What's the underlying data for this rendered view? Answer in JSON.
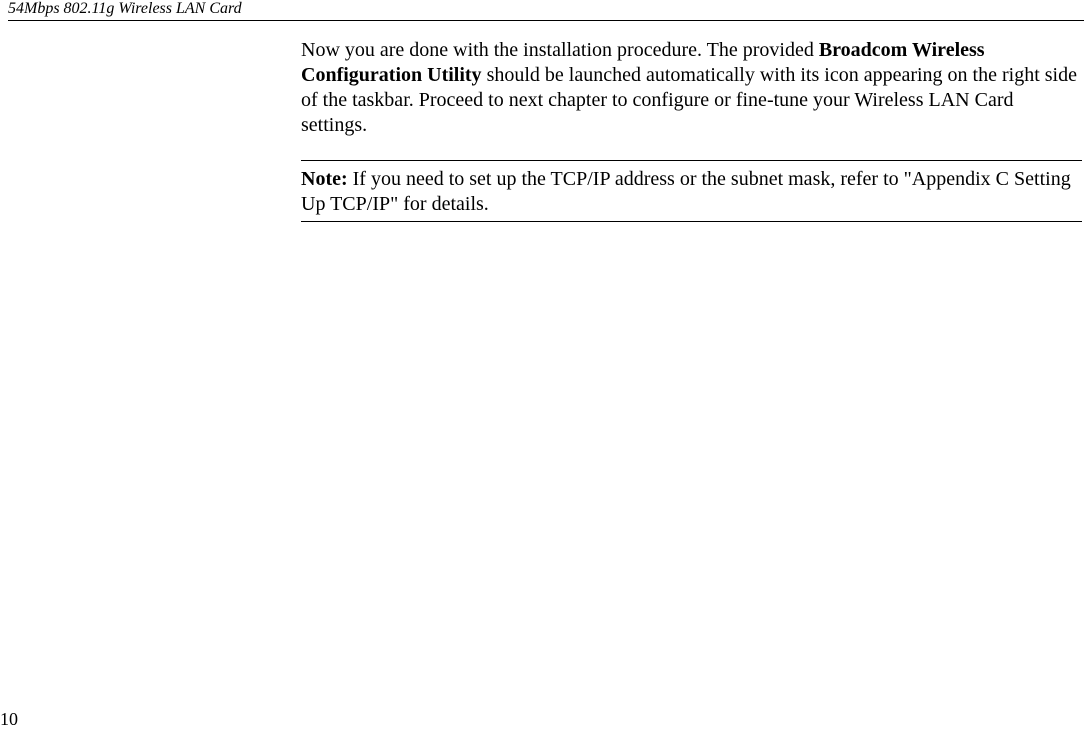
{
  "header": {
    "title": "54Mbps 802.11g Wireless LAN Card"
  },
  "body": {
    "para_part1": "Now you are done with the installation procedure. The provided ",
    "para_bold1": "Broadcom Wireless Configuration Utility",
    "para_part2": " should be launched automatically with its icon appearing on the right side of the taskbar. Proceed to next chapter to configure or fine-tune your Wireless LAN Card settings.",
    "note_label": "Note:",
    "note_text": " If you need to set up the TCP/IP address or the subnet mask, refer to \"Appendix  C Setting Up TCP/IP\" for details."
  },
  "footer": {
    "page_number": "10"
  }
}
